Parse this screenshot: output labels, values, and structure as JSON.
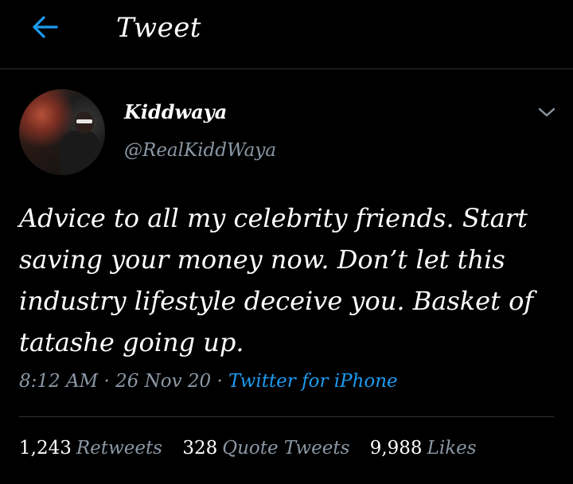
{
  "header": {
    "title": "Tweet",
    "back_icon": "arrow-left-icon",
    "accent_color": "#1d9bf0"
  },
  "author": {
    "display_name": "Kiddwaya",
    "handle": "@RealKiddWaya",
    "more_icon": "chevron-down-icon"
  },
  "tweet": {
    "text": "Advice to all my celebrity friends. Start saving your money now. Don’t let this industry lifestyle deceive you. Basket of tatashe going up."
  },
  "meta": {
    "time": "8:12 AM",
    "separator": "·",
    "date": "26 Nov 20",
    "source": "Twitter for iPhone"
  },
  "stats": {
    "retweets": {
      "count": "1,243",
      "label": "Retweets"
    },
    "quote_tweets": {
      "count": "328",
      "label": "Quote Tweets"
    },
    "likes": {
      "count": "9,988",
      "label": "Likes"
    }
  },
  "colors": {
    "background": "#000000",
    "text_primary": "#ffffff",
    "text_secondary": "#8b98a5",
    "divider": "#2f3336"
  }
}
